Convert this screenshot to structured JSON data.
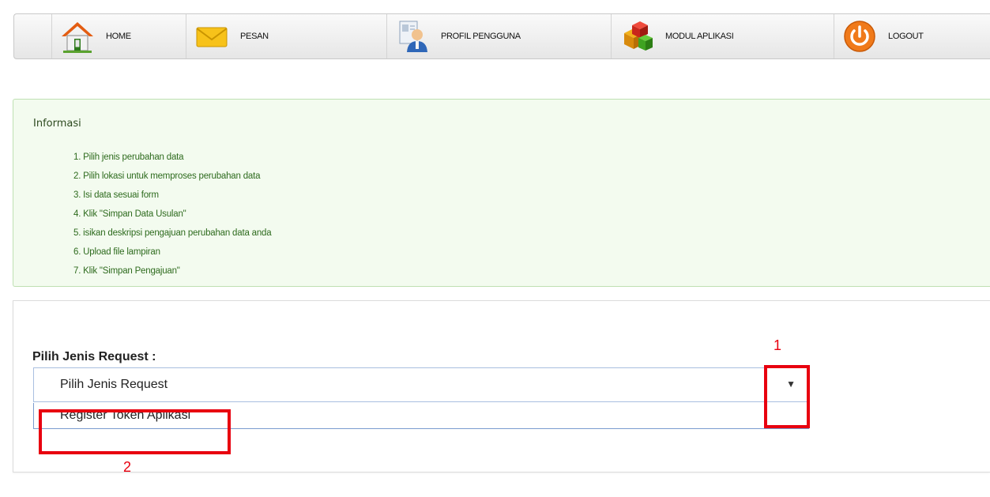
{
  "nav": {
    "items": [
      {
        "label": "HOME",
        "icon": "home-icon"
      },
      {
        "label": "PESAN",
        "icon": "mail-icon"
      },
      {
        "label": "PROFIL PENGGUNA",
        "icon": "user-profile-icon"
      },
      {
        "label": "MODUL APLIKASI",
        "icon": "modules-icon"
      },
      {
        "label": "LOGOUT",
        "icon": "power-icon"
      }
    ]
  },
  "info": {
    "title": "Informasi",
    "items": [
      "1. Pilih jenis perubahan data",
      "2. Pilih lokasi untuk memproses perubahan data",
      "3. Isi data sesuai form",
      "4. Klik \"Simpan Data Usulan\"",
      "5. isikan deskripsi pengajuan perubahan data anda",
      "6. Upload file lampiran",
      "7. Klik \"Simpan Pengajuan\""
    ]
  },
  "form": {
    "label": "Pilih Jenis Request :",
    "select": {
      "selected": "Pilih Jenis Request",
      "options": [
        "Register Token Aplikasi"
      ]
    }
  },
  "annotations": {
    "one": "1",
    "two": "2"
  },
  "colors": {
    "annotation": "#e8000f",
    "info_bg": "#f3fbef",
    "info_text": "#2e6b1e"
  }
}
